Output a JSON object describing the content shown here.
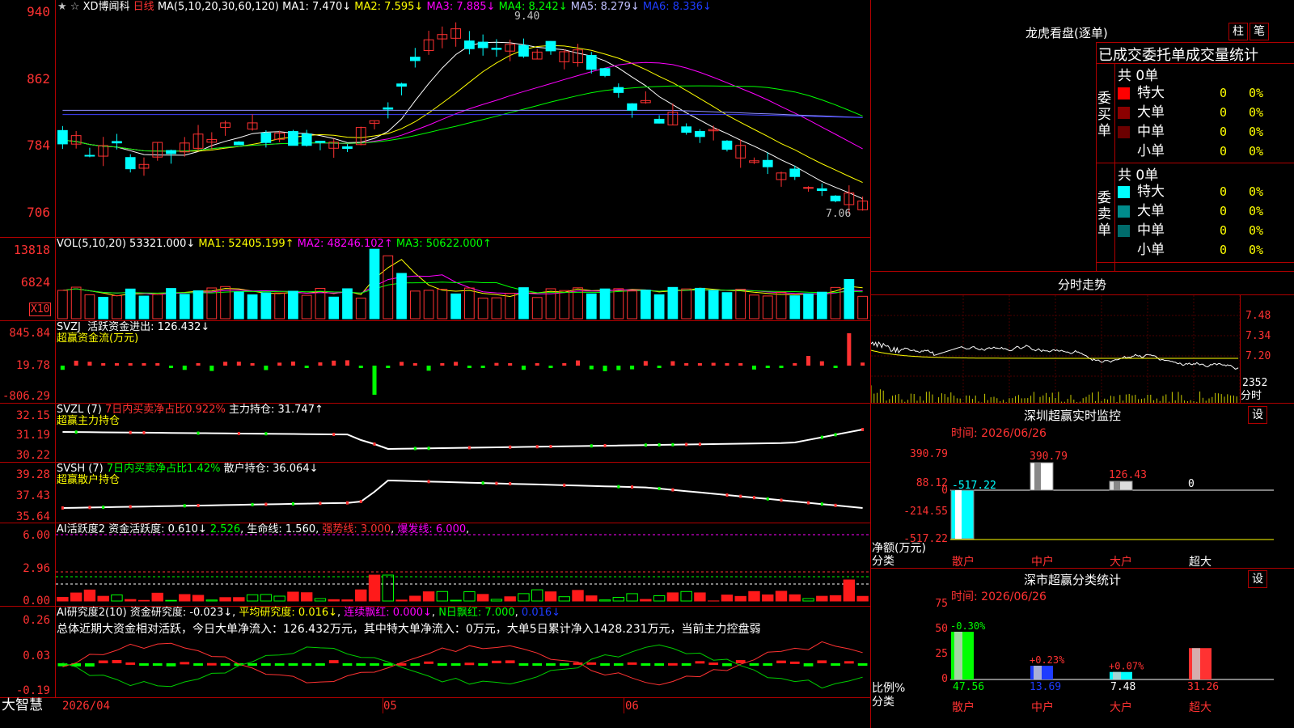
{
  "main": {
    "title": "XD博闻科",
    "star": "★",
    "star_hollow": "☆",
    "period": "日线",
    "ma_label": "MA(5,10,20,30,60,120)",
    "ma1": "MA1: 7.470↓",
    "ma2": "MA2: 7.595↓",
    "ma3": "MA3: 7.885↓",
    "ma4": "MA4: 8.242↓",
    "ma5": "MA5: 8.279↓",
    "ma6": "MA6: 8.336↓",
    "y_ticks": [
      "940",
      "862",
      "784",
      "706"
    ],
    "high_label": "9.40",
    "low_label": "7.06",
    "colors": {
      "up": "#ff3232",
      "down": "#00ffff",
      "ma1": "#ffffff",
      "ma2": "#ffff00",
      "ma3": "#ff00ff",
      "ma4": "#00ff00",
      "ma5": "#9090ff",
      "ma6": "#4040ff"
    }
  },
  "vol": {
    "label": "VOL(5,10,20)",
    "value": "53321.000↓",
    "ma1": "MA1: 52405.199↑",
    "ma2": "MA2: 48246.102↑",
    "ma3": "MA3: 50622.000↑",
    "y_ticks": [
      "13818",
      "6824"
    ],
    "unit": "X10"
  },
  "svzj": {
    "label": "SVZJ",
    "active": "活跃资金进出: 126.432↓",
    "sub": "超赢资金流(万元)",
    "y_ticks": [
      "845.84",
      "19.78",
      "-806.29"
    ]
  },
  "svzl": {
    "label": "SVZL (7)",
    "ratio": "7日内买卖净占比0.922%",
    "hold": "主力持仓: 31.747↑",
    "sub": "超赢主力持仓",
    "y_ticks": [
      "32.15",
      "31.19",
      "30.22"
    ]
  },
  "svsh": {
    "label": "SVSH (7)",
    "ratio": "7日内买卖净占比1.42%",
    "hold": "散户持仓: 36.064↓",
    "sub": "超赢散户持仓",
    "y_ticks": [
      "39.28",
      "37.43",
      "35.64"
    ]
  },
  "ai1": {
    "label": "AI活跃度2",
    "active": "资金活跃度: 0.610↓",
    "v2": "2.526",
    "life": "生命线: 1.560",
    "strong": "强势线: 3.000",
    "burst": "爆发线: 6.000",
    "y_ticks": [
      "6.00",
      "2.96",
      "0.00"
    ]
  },
  "ai2": {
    "label": "AI研究度2(10)",
    "research": "资金研究度: -0.023↓",
    "avg": "平均研究度: 0.016↓",
    "lianxu": "连续飘红: 0.000↓",
    "nday": "N日飘红: 7.000",
    "last": "0.016↓",
    "summary": "总体近期大资金相对活跃，今日大单净流入：126.432万元，其中特大单净流入：0万元，大单5日累计净入1428.231万元，当前主力控盘弱",
    "y_ticks": [
      "0.26",
      "0.03",
      "-0.19"
    ]
  },
  "xaxis": {
    "brand": "大智慧",
    "d1": "2026/04",
    "d2": "05",
    "d3": "06"
  },
  "lhb": {
    "title": "龙虎看盘(逐单)",
    "btn1": "柱",
    "btn2": "笔",
    "header": "已成交委托单成交量统计",
    "buy_total": "共 0单",
    "buy_side": "委买单",
    "sell_total": "共 0单",
    "sell_side": "委卖单",
    "buy_rows": [
      {
        "label": "特大",
        "val": "0",
        "pct": "0%",
        "color": "#ff0000"
      },
      {
        "label": "大单",
        "val": "0",
        "pct": "0%",
        "color": "#8b0000"
      },
      {
        "label": "中单",
        "val": "0",
        "pct": "0%",
        "color": "#6b0000"
      },
      {
        "label": "小单",
        "val": "0",
        "pct": "0%",
        "color": ""
      }
    ],
    "sell_rows": [
      {
        "label": "特大",
        "val": "0",
        "pct": "0%",
        "color": "#00ffff"
      },
      {
        "label": "大单",
        "val": "0",
        "pct": "0%",
        "color": "#008b8b"
      },
      {
        "label": "中单",
        "val": "0",
        "pct": "0%",
        "color": "#006b6b"
      },
      {
        "label": "小单",
        "val": "0",
        "pct": "0%",
        "color": ""
      }
    ]
  },
  "fenshi": {
    "title": "分时走势",
    "y_ticks": [
      "7.48",
      "7.34",
      "7.20"
    ],
    "vol_tick": "2352",
    "vol_label": "分时"
  },
  "monitor": {
    "title": "深圳超赢实时监控",
    "set": "设",
    "time": "时间: 2026/06/26",
    "y_ticks": [
      "390.79",
      "88.12",
      "0",
      "-214.55",
      "-517.22"
    ],
    "unit": "净额(万元)",
    "cat_label": "分类",
    "cats": [
      "散户",
      "中户",
      "大户",
      "超大"
    ],
    "values": [
      "-517.22",
      "390.79",
      "126.43",
      "0"
    ]
  },
  "classify": {
    "title": "深市超赢分类统计",
    "set": "设",
    "time": "时间: 2026/06/26",
    "y_ticks": [
      "75",
      "50",
      "25",
      "0"
    ],
    "unit": "比例%",
    "cat_label": "分类",
    "cats": [
      "散户",
      "中户",
      "大户",
      "超大"
    ],
    "values": [
      "47.56",
      "13.69",
      "7.48",
      "31.26"
    ],
    "deltas": [
      "-0.30%",
      "+0.23%",
      "+0.07%",
      ""
    ]
  }
}
